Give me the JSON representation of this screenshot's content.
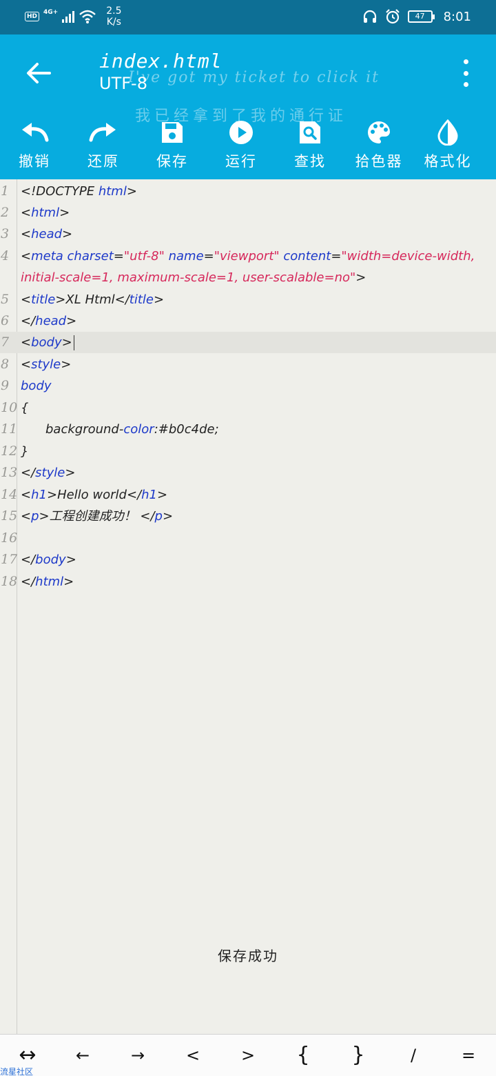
{
  "status_bar": {
    "hd": "HD",
    "network": "4G+",
    "speed_value": "2.5",
    "speed_unit": "K/s",
    "battery": "47",
    "time": "8:01"
  },
  "header": {
    "title": "index.html",
    "encoding": "UTF-8",
    "watermark_en": "I've got my ticket to click it",
    "watermark_zh": "我已经拿到了我的通行证"
  },
  "toolbar": {
    "undo": "撤销",
    "redo": "还原",
    "save": "保存",
    "run": "运行",
    "find": "查找",
    "color_picker": "拾色器",
    "format": "格式化"
  },
  "editor": {
    "line_numbers": [
      "1",
      "2",
      "3",
      "4",
      "5",
      "6",
      "7",
      "8",
      "9",
      "10",
      "11",
      "12",
      "13",
      "14",
      "15",
      "16",
      "17",
      "18"
    ],
    "active_line": "7",
    "code": {
      "l1_pre": "<!DOCTYPE ",
      "l1_tag": "html",
      "l1_post": ">",
      "l2_open": "<",
      "l2_tag": "html",
      "l2_close": ">",
      "l3_open": "<",
      "l3_tag": "head",
      "l3_close": ">",
      "l4_open": "<",
      "l4_tag": "meta",
      "l4_attr1": "charset",
      "l4_eq1": "=",
      "l4_val1": "\"utf-8\"",
      "l4_attr2": "name",
      "l4_eq2": "=",
      "l4_val2": "\"viewport\"",
      "l4_attr3": "content",
      "l4_eq3": "=",
      "l4_val3a": "\"width=device-width,",
      "l4_val3b": "initial-scale=1, maximum-scale=1, user-scalable=no\"",
      "l4_close": ">",
      "l5_open": "<",
      "l5_tag": "title",
      "l5_gt": ">",
      "l5_text": "XL Html",
      "l5_lt": "</",
      "l5_tag2": "title",
      "l5_close": ">",
      "l6_open": "</",
      "l6_tag": "head",
      "l6_close": ">",
      "l7_open": "<",
      "l7_tag": "body",
      "l7_close": ">",
      "l8_open": "<",
      "l8_tag": "style",
      "l8_close": ">",
      "l9_sel": "body",
      "l10_brace": "{",
      "l11_prop_a": "background-",
      "l11_prop_b": "color",
      "l11_colon": ":",
      "l11_val": "#b0c4de;",
      "l12_brace": "}",
      "l13_open": "</",
      "l13_tag": "style",
      "l13_close": ">",
      "l14_open": "<",
      "l14_tag": "h1",
      "l14_gt": ">",
      "l14_text": "Hello world",
      "l14_lt": "</",
      "l14_tag2": "h1",
      "l14_close": ">",
      "l15_open": "<",
      "l15_tag": "p",
      "l15_gt": ">",
      "l15_text": "工程创建成功！",
      "l15_lt": "</",
      "l15_tag2": "p",
      "l15_close": ">",
      "l17_open": "</",
      "l17_tag": "body",
      "l17_close": ">",
      "l18_open": "</",
      "l18_tag": "html",
      "l18_close": ">"
    }
  },
  "toast": "保存成功",
  "symbol_bar": [
    "↔",
    "←",
    "→",
    "<",
    ">",
    "{",
    "}",
    "/",
    "="
  ],
  "corner_watermark": "流星社区",
  "colors": {
    "status_bar": "#0d6f95",
    "app_bar": "#07acdf",
    "tag": "#1d39c9",
    "string": "#d6285b",
    "editor_bg": "#efefea"
  }
}
